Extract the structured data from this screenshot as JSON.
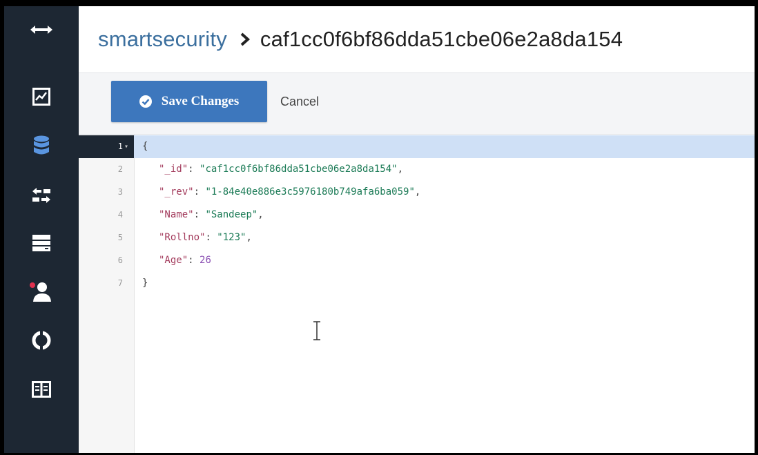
{
  "sidebar": {
    "items": [
      {
        "icon": "expand-arrows-icon"
      },
      {
        "icon": "activity-chart-icon"
      },
      {
        "icon": "database-icon"
      },
      {
        "icon": "replication-icon"
      },
      {
        "icon": "server-icon"
      },
      {
        "icon": "user-notification-icon"
      },
      {
        "icon": "support-lifebuoy-icon"
      },
      {
        "icon": "documentation-book-icon"
      }
    ]
  },
  "header": {
    "database": "smartsecurity",
    "document_id": "caf1cc0f6bf86dda51cbe06e2a8da154"
  },
  "toolbar": {
    "save_label": "Save Changes",
    "cancel_label": "Cancel"
  },
  "editor": {
    "lines": [
      {
        "num": "1",
        "open": "{"
      },
      {
        "num": "2",
        "key": "\"_id\"",
        "value": "\"caf1cc0f6bf86dda51cbe06e2a8da154\"",
        "trail": ","
      },
      {
        "num": "3",
        "key": "\"_rev\"",
        "value": "\"1-84e40e886e3c5976180b749afa6ba059\"",
        "trail": ","
      },
      {
        "num": "4",
        "key": "\"Name\"",
        "value": "\"Sandeep\"",
        "trail": ","
      },
      {
        "num": "5",
        "key": "\"Rollno\"",
        "value": "\"123\"",
        "trail": ","
      },
      {
        "num": "6",
        "key": "\"Age\"",
        "value": "26",
        "trail": ""
      },
      {
        "num": "7",
        "open": "}"
      }
    ]
  },
  "colors": {
    "sidebar_bg": "#1d2733",
    "accent": "#3d77bd",
    "breadcrumb_link": "#3b6f9e",
    "json_key": "#a33b5c",
    "json_string": "#1a7a55",
    "json_number": "#8a4fb3"
  }
}
